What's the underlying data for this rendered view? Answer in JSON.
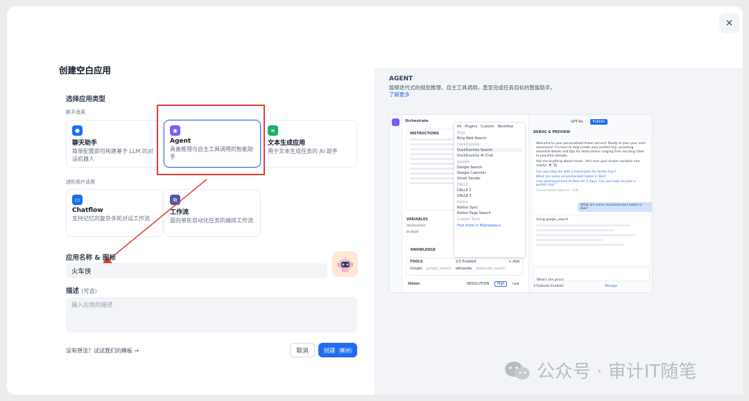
{
  "dialog": {
    "title": "创建空白应用",
    "close_icon": "close-icon",
    "type_section_label": "选择应用类型",
    "beginner_label": "新手适用",
    "advanced_label": "进阶用户适用",
    "app_types": [
      {
        "icon": "chat-bubble-icon",
        "color": "#1570ef",
        "title": "聊天助手",
        "desc": "简单配置即可构建基于 LLM 的对话机器人"
      },
      {
        "icon": "agent-icon",
        "color": "#7a5af8",
        "title": "Agent",
        "desc": "具备推理与自主工具调用的智能助手",
        "selected": true
      },
      {
        "icon": "text-generation-icon",
        "color": "#17b26a",
        "title": "文本生成应用",
        "desc": "用于文本生成任务的 AI 助手"
      },
      {
        "icon": "chatflow-icon",
        "color": "#1570ef",
        "title": "Chatflow",
        "desc": "支持记忆的复杂多轮对话工作流"
      },
      {
        "icon": "workflow-icon",
        "color": "#4e5ba6",
        "title": "工作流",
        "desc": "面向单轮自动化任务的编排工作流"
      }
    ],
    "name_icon_label": "应用名称 & 图标",
    "app_name_value": "火车侠",
    "desc_label": "描述",
    "desc_optional": "(可选)",
    "desc_placeholder": "输入应用的描述",
    "template_link": "没有想法？试试我们的模板 →",
    "cancel_label": "取消",
    "create_label": "创建",
    "create_shortcut": "⌘ ↵"
  },
  "preview": {
    "heading": "AGENT",
    "description": "能够迭代式的规划推理、自主工具调用，直至完成任务目标的智能助手。",
    "learn_more": "了解更多",
    "screenshot": {
      "left_title": "Orchestrate",
      "instructions": "INSTRUCTIONS",
      "variables": "VARIABLES",
      "var1": "destination",
      "var2": "budget",
      "knowledge": "KNOWLEDGE",
      "tools": "TOOLS",
      "tools_enabled": "2/3 Enabled",
      "tool_add": "+ Add",
      "tool1": "Google",
      "tool1_sub": "google_search",
      "tool2": "wikipedia",
      "tool2_sub": "wikipedia_search",
      "vision": "Vision",
      "resolution": "RESOLUTION",
      "res_high": "High",
      "res_low": "Low",
      "dropdown_tabs": [
        "All",
        "Plugins",
        "Custom",
        "Workflow"
      ],
      "dropdown_items": [
        "Bing Web Search",
        "DuckDuckGo Search",
        "DuckDuckGo AI Chat",
        "Google Search",
        "Google Calendar",
        "Gmail Sender",
        "DALLE 2",
        "DALLE 3",
        "Notion Sync",
        "Notion Page Search"
      ],
      "dropdown_groups": [
        "Bing",
        "DuckDuckGo",
        "Google",
        "DALLE",
        "Notion",
        "Custom Tools"
      ],
      "find_more": "Find more in Marketplace",
      "model": "GPT-4o",
      "publish": "Publish",
      "debug_title": "DEBUG & PREVIEW",
      "welcome": "Welcome to your personalized travel service! Ready to plan your next adventure? I'm here to help create your perfect trip, providing essential details and tips for destinations ranging from exciting cities to peaceful retreats.",
      "ask_me": "Ask me anything about travel - let's turn your dream vacation into reality! 🌴 ✈️",
      "q1": "Can you help me with a travel plan for family trips?",
      "q2": "What are some recommended hotels in Bali?",
      "q3": "I am planning travel to Paris for 5 days. Can you help me plan a perfect trip?",
      "opener": "Conversation Opener · Edit",
      "user_msg": "What are some recommended hotels in Bali?",
      "using": "Using google_search",
      "input_placeholder": "What's the price?",
      "features": "3 Features Enabled",
      "manage": "Manage"
    }
  },
  "watermark": {
    "text": "公众号 · 审计IT随笔"
  }
}
